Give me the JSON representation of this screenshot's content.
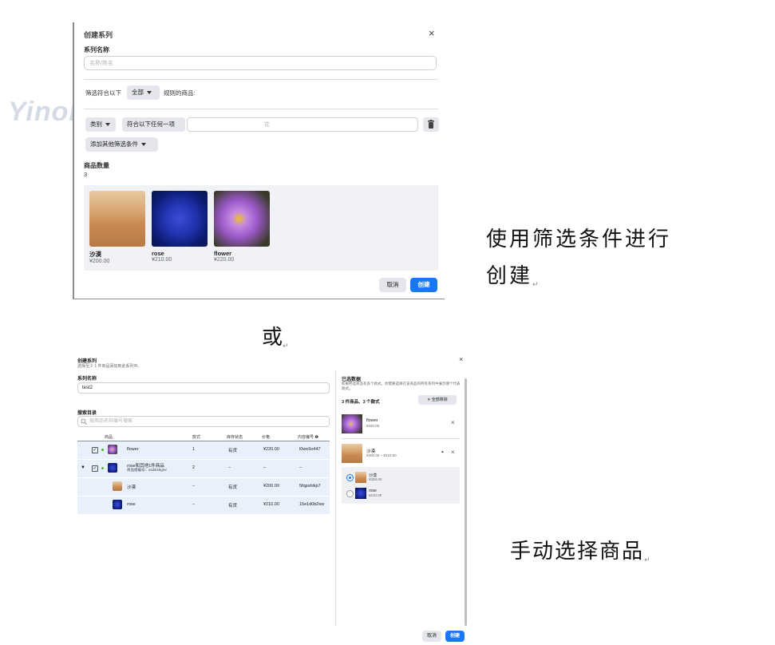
{
  "dialog1": {
    "title": "创建系列",
    "close": "×",
    "name_label": "系列名称",
    "name_placeholder": "名称/姓名",
    "filter_prefix": "筛选符合以下",
    "filter_mode": "全部",
    "filter_suffix": "规则的商品:",
    "filter_field": "类别",
    "filter_op": "符合以下任何一项",
    "filter_value_placeholder": "花",
    "add_filter": "添加其他筛选条件",
    "count_label": "商品数量",
    "count_value": "3",
    "products": [
      {
        "name": "沙漠",
        "price": "¥200.00"
      },
      {
        "name": "rose",
        "price": "¥210.00"
      },
      {
        "name": "flower",
        "price": "¥220.00"
      }
    ],
    "cancel": "取消",
    "create": "创建"
  },
  "watermark": "YinoLink易诺",
  "caption1_line1": "使用筛选条件进行",
  "caption1_line2": "创建",
  "or_text": "或",
  "caption2": "手动选择商品",
  "return_mark": "↵",
  "dialog2": {
    "title": "创建系列",
    "subtitle": "选择至少 1 件商品添加到此系列中。",
    "close": "×",
    "name_label": "系列名称",
    "name_value": "test2",
    "catalog_label": "搜索目录",
    "search_placeholder": "按商品名称编号搜索",
    "columns": [
      "商品",
      "款式",
      "库存状态",
      "价格",
      "内容编号 ❶"
    ],
    "rows": [
      {
        "name": "flower",
        "variants": "1",
        "stock": "有货",
        "price": "¥220.00",
        "id": "l0we9o447"
      },
      {
        "name": "rose和其他1件商品",
        "sub": "商品组编号：ssdsl49gmr",
        "variants": "2",
        "stock": "–",
        "price": "–",
        "id": "–"
      },
      {
        "name": "沙漠",
        "variants": "–",
        "stock": "有货",
        "price": "¥200.00",
        "id": "5fqpshikp7"
      },
      {
        "name": "rose",
        "variants": "–",
        "stock": "有货",
        "price": "¥210.00",
        "id": "15e1d0b2sw"
      }
    ],
    "selected_title": "已选数据",
    "selected_desc": "如果所选商品有多个款式，你需要选择在该商品的所有系列中展示哪个代表款式。",
    "selected_count": "3 件商品、3 个款式",
    "clear_all": "全部移除",
    "selected_items": [
      {
        "name": "flower",
        "price": "¥220.00"
      },
      {
        "name": "沙漠",
        "price": "¥200.00 ~ ¥210.00"
      }
    ],
    "variants": [
      {
        "name": "沙漠",
        "price": "¥200.00"
      },
      {
        "name": "rose",
        "price": "¥210.00"
      }
    ],
    "cancel": "取消",
    "create": "创建"
  }
}
